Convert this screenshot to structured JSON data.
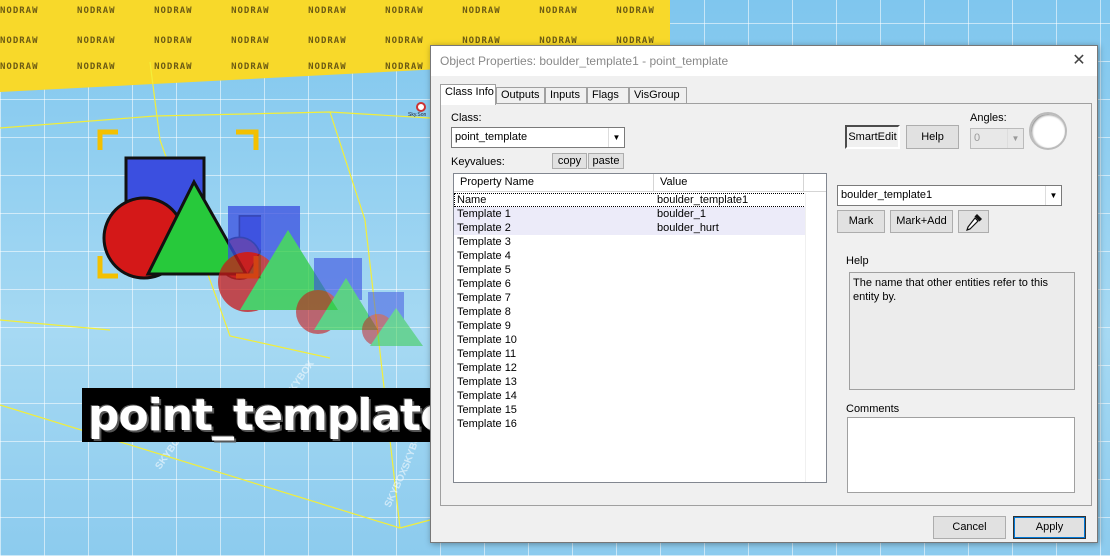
{
  "viewport": {
    "nodraw_text": "NODRAW",
    "entity_label": "point_template",
    "skybox_text": "SKYBOX",
    "entity_tag": "Sky.Son"
  },
  "dialog": {
    "title": "Object Properties: boulder_template1 - point_template",
    "close_glyph": "✕",
    "tabs": [
      {
        "label": "Class Info",
        "active": true
      },
      {
        "label": "Outputs",
        "active": false
      },
      {
        "label": "Inputs",
        "active": false
      },
      {
        "label": "Flags",
        "active": false
      },
      {
        "label": "VisGroup",
        "active": false
      }
    ],
    "class_label": "Class:",
    "class_value": "point_template",
    "keyvalues_label": "Keyvalues:",
    "copy_label": "copy",
    "paste_label": "paste",
    "smartedit_label": "SmartEdit",
    "help_button_label": "Help",
    "angles_label": "Angles:",
    "angles_value": "0",
    "property_columns": [
      "Property Name",
      "Value"
    ],
    "properties": [
      {
        "name": "Name",
        "value": "boulder_template1"
      },
      {
        "name": "Template 1",
        "value": "boulder_1"
      },
      {
        "name": "Template 2",
        "value": "boulder_hurt"
      },
      {
        "name": "Template 3",
        "value": ""
      },
      {
        "name": "Template 4",
        "value": ""
      },
      {
        "name": "Template 5",
        "value": ""
      },
      {
        "name": "Template 6",
        "value": ""
      },
      {
        "name": "Template 7",
        "value": ""
      },
      {
        "name": "Template 8",
        "value": ""
      },
      {
        "name": "Template 9",
        "value": ""
      },
      {
        "name": "Template 10",
        "value": ""
      },
      {
        "name": "Template 11",
        "value": ""
      },
      {
        "name": "Template 12",
        "value": ""
      },
      {
        "name": "Template 13",
        "value": ""
      },
      {
        "name": "Template 14",
        "value": ""
      },
      {
        "name": "Template 15",
        "value": ""
      },
      {
        "name": "Template 16",
        "value": ""
      }
    ],
    "value_combo": "boulder_template1",
    "mark_label": "Mark",
    "mark_add_label": "Mark+Add",
    "eyedropper_icon": "eyedropper-icon",
    "help_section_label": "Help",
    "help_text": "The name that other entities refer to this entity by.",
    "comments_label": "Comments",
    "comments_value": "",
    "cancel_label": "Cancel",
    "apply_label": "Apply"
  },
  "colors": {
    "wall_yellow": "#f8d92a",
    "viewport_blue": "#9fd3ee",
    "row_alt": "#ecebf9",
    "box_outline": "#f0ec3c"
  }
}
